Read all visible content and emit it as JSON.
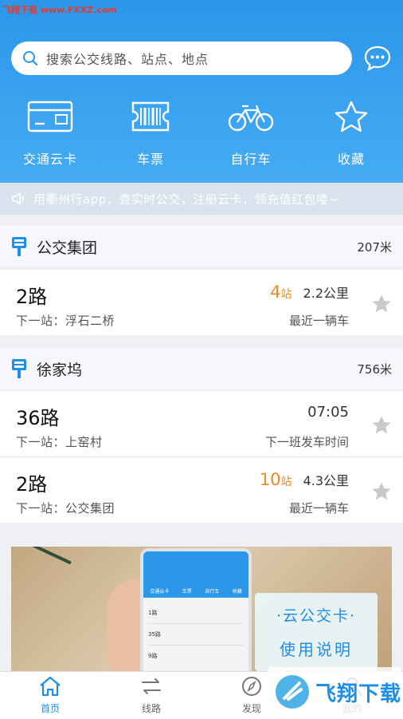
{
  "watermark": "飞翔下载 www.FXXZ.com",
  "search": {
    "placeholder": "搜索公交线路、站点、地点"
  },
  "quick_actions": [
    {
      "label": "交通云卡",
      "icon": "transit-card-icon"
    },
    {
      "label": "车票",
      "icon": "ticket-icon"
    },
    {
      "label": "自行车",
      "icon": "bicycle-icon"
    },
    {
      "label": "收藏",
      "icon": "star-outline-icon"
    }
  ],
  "notice": {
    "text": "用衢州行app，查实时公交，注册云卡，领充值红包喽~",
    "icon": "speaker-icon"
  },
  "groups": [
    {
      "name": "公交集团",
      "distance": "207米",
      "rows": [
        {
          "route": "2路",
          "next": "下一站：浮石二桥",
          "stops_num": "4",
          "stops_unit": "站",
          "distance": "2.2公里",
          "status": "最近一辆车"
        }
      ]
    },
    {
      "name": "徐家坞",
      "distance": "756米",
      "rows": [
        {
          "route": "36路",
          "next": "下一站：上窑村",
          "time": "07:05",
          "status": "下一班发车时间"
        },
        {
          "route": "2路",
          "next": "下一站：公交集团",
          "stops_num": "10",
          "stops_unit": "站",
          "distance": "4.3公里",
          "status": "最近一辆车"
        }
      ]
    }
  ],
  "banner": {
    "card_line1": "·云公交卡·",
    "card_line2": "使用说明",
    "phone_items": [
      "交通云卡",
      "车票",
      "自行车",
      "收藏"
    ],
    "phone_rows": [
      "1路",
      "35路",
      "9路"
    ],
    "overlay_brand": "飞翔下载"
  },
  "tabbar": [
    {
      "label": "首页",
      "icon": "home-icon",
      "active": true
    },
    {
      "label": "线路",
      "icon": "route-arrows-icon",
      "active": false
    },
    {
      "label": "发现",
      "icon": "compass-icon",
      "active": false
    },
    {
      "label": "我的",
      "icon": "profile-icon",
      "active": false
    }
  ],
  "colors": {
    "accent": "#2a97ea",
    "orange": "#f08a1c",
    "tab_active": "#1e8fe8"
  }
}
